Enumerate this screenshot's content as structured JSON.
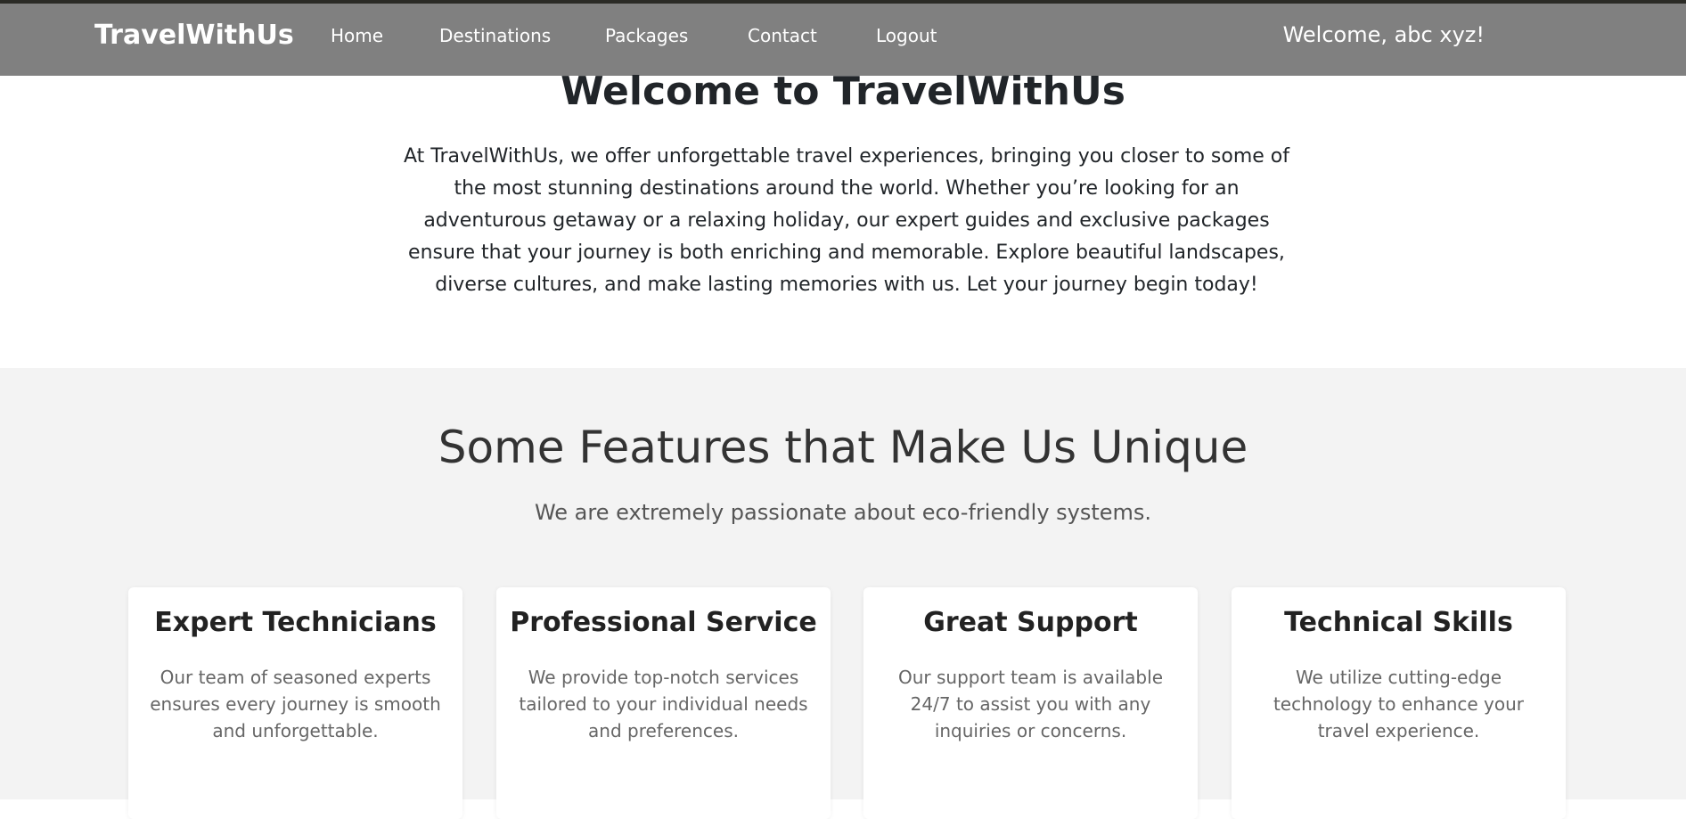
{
  "navbar": {
    "brand": "TravelWithUs",
    "links": [
      "Home",
      "Destinations",
      "Packages",
      "Contact",
      "Logout"
    ],
    "welcome": "Welcome, abc xyz!",
    "background_color": "#808080"
  },
  "hero": {
    "title": "Welcome to TravelWithUs",
    "text": "At TravelWithUs, we offer unforgettable travel experiences, bringing you closer to some of the most stunning destinations around the world. Whether you’re looking for an adventurous getaway or a relaxing holiday, our expert guides and exclusive packages ensure that your journey is both enriching and memorable. Explore beautiful landscapes, diverse cultures, and make lasting memories with us. Let your journey begin today!"
  },
  "features": {
    "title": "Some Features that Make Us Unique",
    "subtitle": "We are extremely passionate about eco-friendly systems.",
    "background_color": "#f3f3f3",
    "cards": [
      {
        "title": "Expert Technicians",
        "text": "Our team of seasoned experts ensures every journey is smooth and unforgettable."
      },
      {
        "title": "Professional Service",
        "text": "We provide top-notch services tailored to your individual needs and preferences."
      },
      {
        "title": "Great Support",
        "text": "Our support team is available 24/7 to assist you with any inquiries or concerns."
      },
      {
        "title": "Technical Skills",
        "text": "We utilize cutting-edge technology to enhance your travel experience."
      }
    ]
  }
}
